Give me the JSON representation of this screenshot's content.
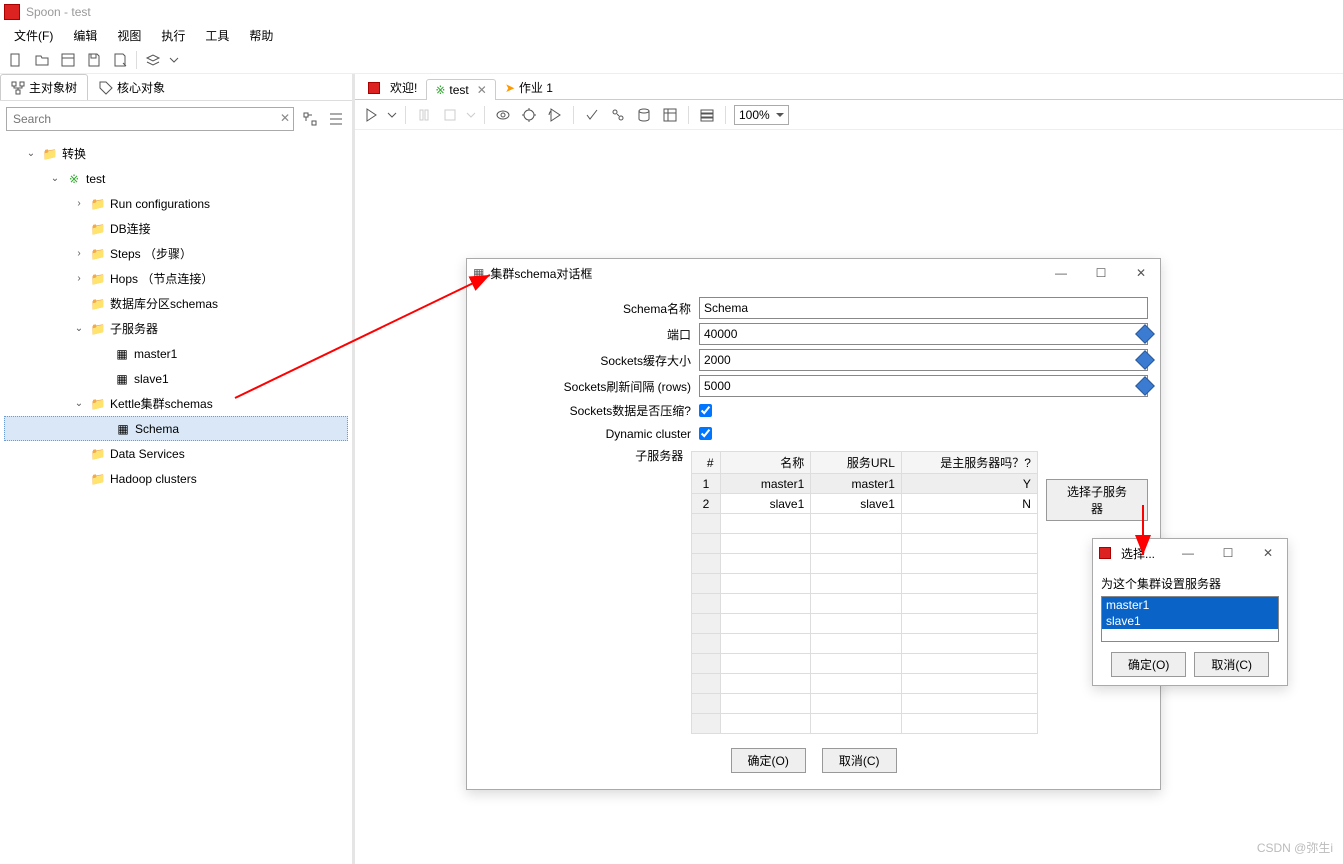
{
  "window": {
    "title": "Spoon - test"
  },
  "menu": {
    "file": "文件(F)",
    "edit": "编辑",
    "view": "视图",
    "run": "执行",
    "tool": "工具",
    "help": "帮助"
  },
  "leftTabs": {
    "tree": "主对象树",
    "core": "核心对象"
  },
  "search": {
    "placeholder": "Search"
  },
  "tree": {
    "root": "转换",
    "test": "test",
    "runcfg": "Run configurations",
    "db": "DB连接",
    "steps": "Steps （步骤）",
    "hops": "Hops （节点连接）",
    "dbpart": "数据库分区schemas",
    "subserver": "子服务器",
    "master1": "master1",
    "slave1": "slave1",
    "cluster": "Kettle集群schemas",
    "schema": "Schema",
    "dataservices": "Data Services",
    "hadoop": "Hadoop clusters"
  },
  "rightTabs": {
    "welcome": "欢迎!",
    "test": "test",
    "job": "作业 1"
  },
  "zoom": "100%",
  "dialog": {
    "title": "集群schema对话框",
    "labels": {
      "name": "Schema名称",
      "port": "端口",
      "buffer": "Sockets缓存大小",
      "flush": "Sockets刷新间隔 (rows)",
      "compress": "Sockets数据是否压缩?",
      "dynamic": "Dynamic cluster",
      "subservers": "子服务器"
    },
    "values": {
      "name": "Schema",
      "port": "40000",
      "buffer": "2000",
      "flush": "5000"
    },
    "table": {
      "headers": {
        "idx": "#",
        "name": "名称",
        "url": "服务URL",
        "master": "是主服务器吗？?"
      },
      "rows": [
        {
          "idx": "1",
          "name": "master1",
          "url": "master1",
          "master": "Y"
        },
        {
          "idx": "2",
          "name": "slave1",
          "url": "slave1",
          "master": "N"
        }
      ]
    },
    "selectBtn": "选择子服务器",
    "ok": "确定(O)",
    "cancel": "取消(C)"
  },
  "selectDialog": {
    "title": "选择...",
    "prompt": "为这个集群设置服务器",
    "options": [
      "master1",
      "slave1"
    ],
    "ok": "确定(O)",
    "cancel": "取消(C)"
  },
  "watermark": "CSDN @弥生i"
}
